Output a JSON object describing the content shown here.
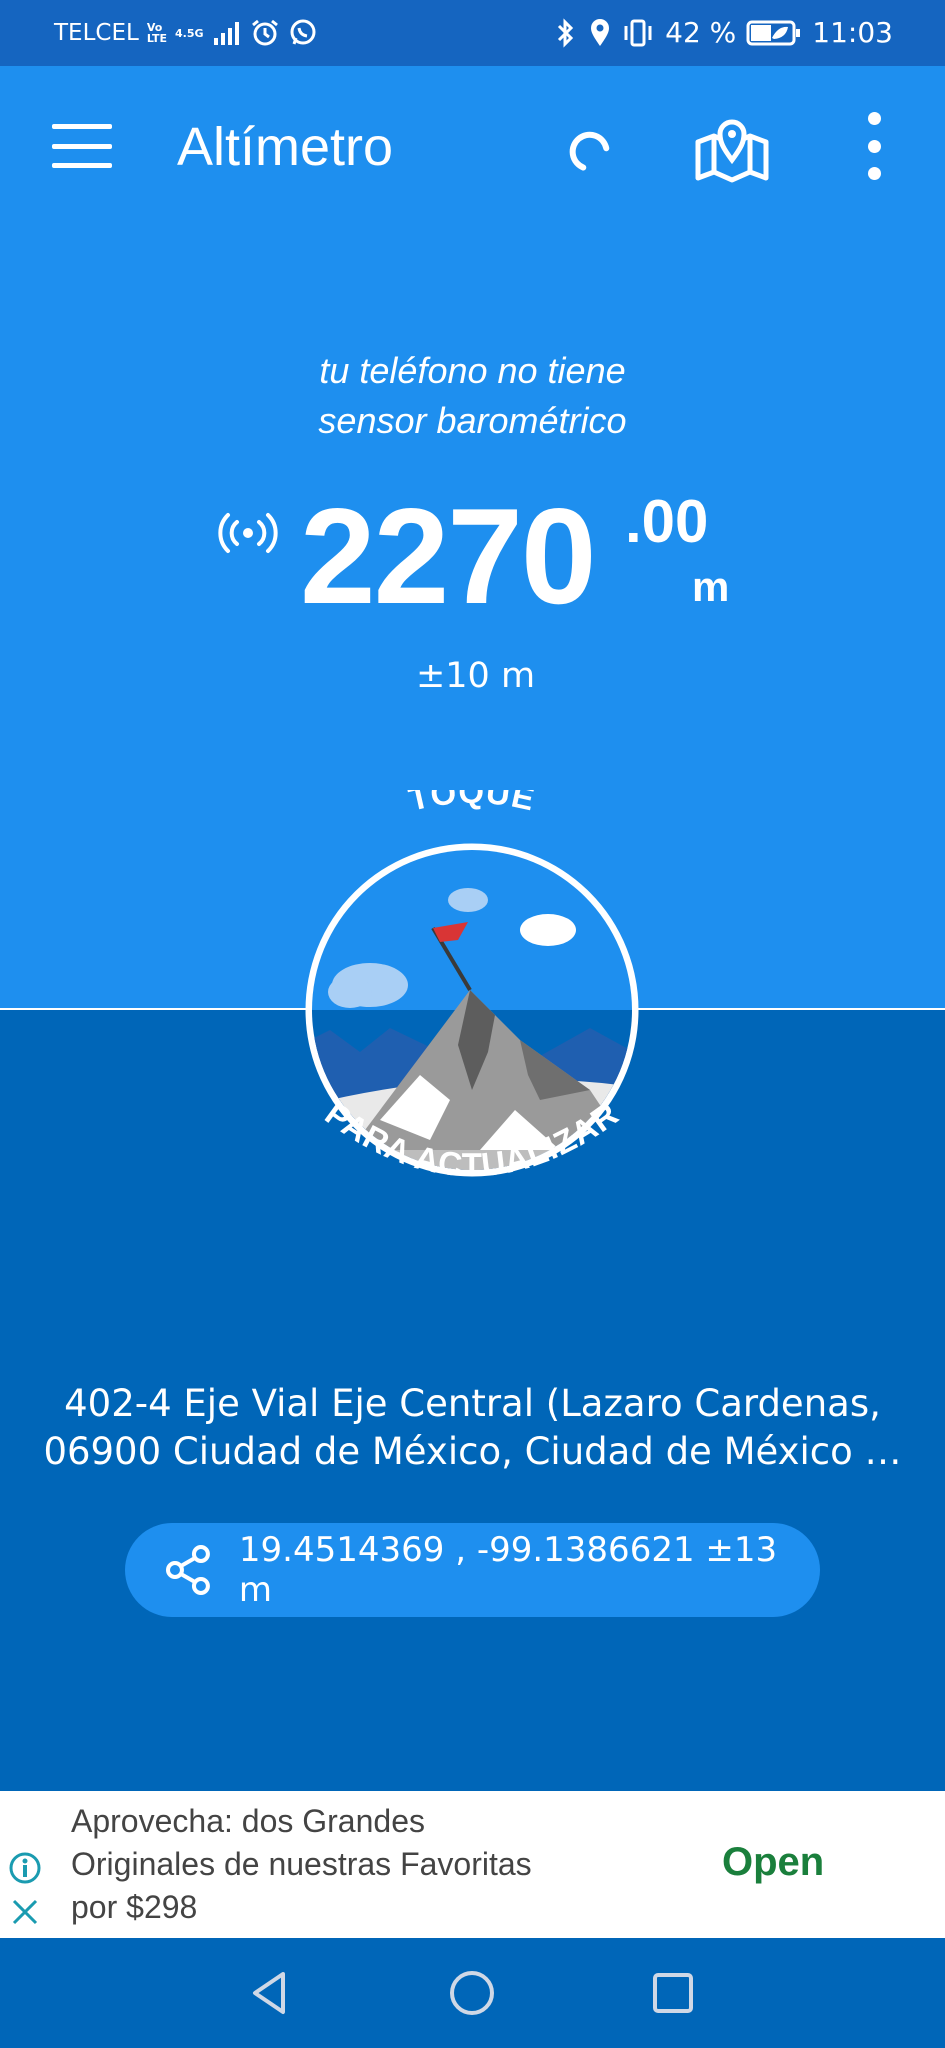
{
  "status_bar": {
    "carrier": "TELCEL",
    "volte_top": "Vo",
    "volte_bottom": "LTE",
    "network": "4.5G",
    "battery": "42 %",
    "time": "11:03",
    "icons": [
      "alarm-icon",
      "whatsapp-icon",
      "bluetooth-icon",
      "location-icon",
      "vibrate-icon",
      "battery-icon"
    ]
  },
  "header": {
    "title": "Altímetro",
    "icons": [
      "menu-icon",
      "refresh-icon",
      "map-icon",
      "more-vert-icon"
    ]
  },
  "reading": {
    "note_line1": "tu teléfono no tiene",
    "note_line2": "sensor barométrico",
    "altitude_int": "2270",
    "altitude_dec": ".00",
    "unit": "m",
    "accuracy": "±10  m",
    "source_icon": "gps-signal-icon"
  },
  "badge": {
    "top_text": "TOQUE",
    "bottom_text": "PARA ACTUALIZAR"
  },
  "location": {
    "address_line1": "402-4 Eje Vial Eje Central (Lazaro Cardenas,",
    "address_line2": "06900 Ciudad de México, Ciudad de México …",
    "coordinates": "19.4514369 , -99.1386621 ±13 m"
  },
  "ad": {
    "text_line1": "Aprovecha: dos Grandes",
    "text_line2": "Originales de nuestras Favoritas",
    "text_line3": "por $298",
    "cta": "Open"
  },
  "colors": {
    "status_bar": "#1565c0",
    "top_panel": "#1e8fef",
    "bottom_panel": "#0066b8",
    "ad_cta": "#1a7f3c"
  }
}
